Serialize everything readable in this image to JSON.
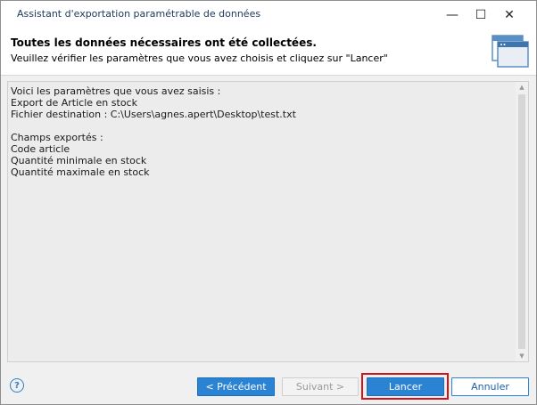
{
  "window": {
    "title": "Assistant d'exportation paramétrable de données",
    "minimize_glyph": "—",
    "maximize_glyph": "☐",
    "close_glyph": "✕"
  },
  "header": {
    "title": "Toutes les données nécessaires ont été collectées.",
    "subtitle": "Veuillez vérifier les paramètres que vous avez choisis et cliquez sur \"Lancer\"",
    "icon": "wizard-window-icon"
  },
  "summary": {
    "lines": [
      "Voici les paramètres que vous avez saisis :",
      "Export de Article en stock",
      "Fichier destination : C:\\Users\\agnes.apert\\Desktop\\test.txt",
      "",
      "Champs exportés :",
      "Code article",
      "Quantité minimale en stock",
      "Quantité maximale en stock"
    ]
  },
  "footer": {
    "help_glyph": "?",
    "prev_label": "< Précédent",
    "next_label": "Suivant >",
    "launch_label": "Lancer",
    "cancel_label": "Annuler"
  },
  "colors": {
    "accent": "#2b83d4",
    "highlight": "#d0141a"
  }
}
